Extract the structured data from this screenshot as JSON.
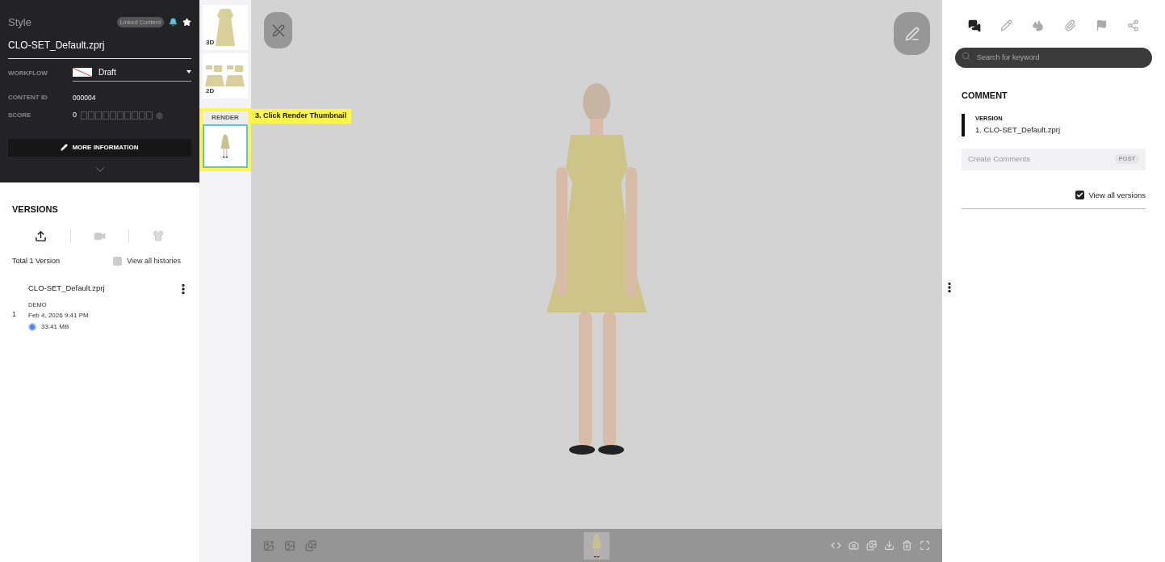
{
  "style_panel": {
    "section": "Style",
    "badge": "Linked Content",
    "file_name": "CLO-SET_Default.zprj",
    "workflow_label": "WORKFLOW",
    "workflow_value": "Draft",
    "content_id_label": "CONTENT ID",
    "content_id": "000004",
    "score_label": "SCORE",
    "score": "0",
    "stars": 0,
    "more_button": "MORE INFORMATION"
  },
  "versions": {
    "title": "VERSIONS",
    "total": "Total 1 Version",
    "view_all_histories": {
      "label": "View all histories",
      "checked": false
    },
    "items": [
      {
        "number": "1",
        "name": "CLO-SET_Default.zprj",
        "user": "DEMO",
        "date": "Feb 4, 2026 9:41 PM",
        "size": "33.41 MB"
      }
    ]
  },
  "thumbnails": [
    {
      "label": "3D",
      "kind": "dress",
      "selected": false
    },
    {
      "label": "2D",
      "kind": "pattern",
      "selected": false
    },
    {
      "label": "RENDER",
      "kind": "render",
      "selected": true
    }
  ],
  "callout": "3. Click Render Thumbnail",
  "comments": {
    "search_placeholder": "Search for keyword",
    "title": "COMMENT",
    "version_label": "VERSION",
    "version_value": "1. CLO-SET_Default.zprj",
    "comment_placeholder": "Create Comments",
    "post_button": "POST",
    "view_all_versions": {
      "label": "View all versions",
      "checked": true
    }
  }
}
